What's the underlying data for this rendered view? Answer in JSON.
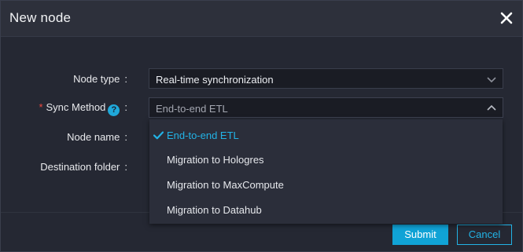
{
  "dialog": {
    "title": "New node",
    "close_icon": "close-icon"
  },
  "form": {
    "node_type_label": "Node type",
    "node_type_value": "Real-time synchronization",
    "sync_method_label": "Sync Method",
    "sync_method_value": "End-to-end ETL",
    "node_name_label": "Node name",
    "destination_folder_label": "Destination folder",
    "colon": ":",
    "required_mark": "*",
    "help_mark": "?"
  },
  "dropdown": {
    "options": [
      {
        "label": "End-to-end ETL",
        "selected": true
      },
      {
        "label": "Migration to Hologres",
        "selected": false
      },
      {
        "label": "Migration to MaxCompute",
        "selected": false
      },
      {
        "label": "Migration to Datahub",
        "selected": false
      }
    ]
  },
  "footer": {
    "submit_label": "Submit",
    "cancel_label": "Cancel"
  },
  "colors": {
    "accent": "#10a3d6",
    "required": "#f0483e",
    "background": "#252833"
  }
}
